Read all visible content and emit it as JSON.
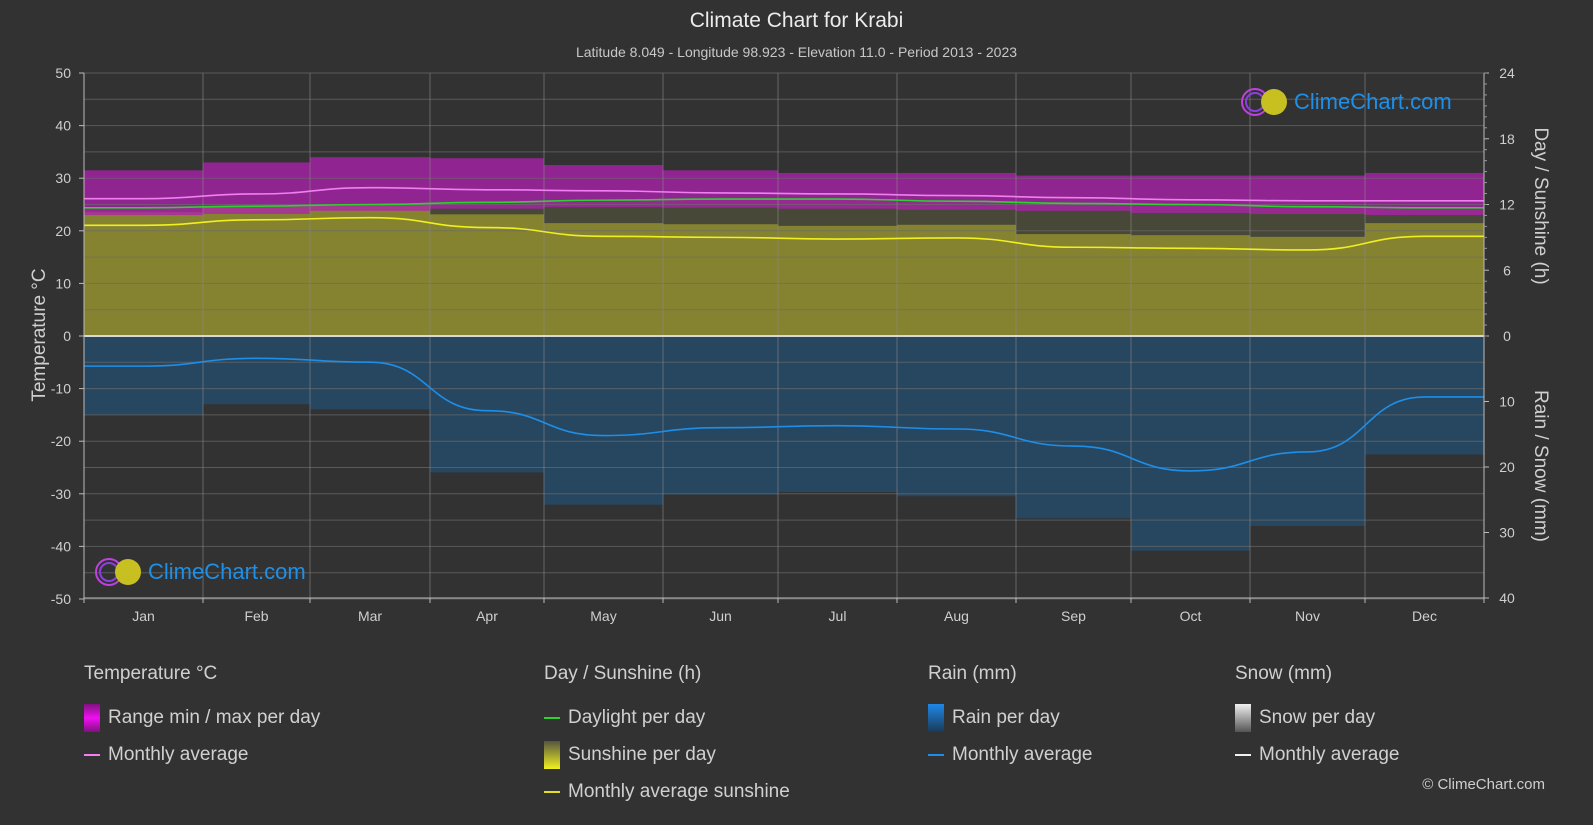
{
  "header": {
    "title": "Climate Chart for Krabi",
    "subtitle": "Latitude 8.049 - Longitude 98.923 - Elevation 11.0 - Period 2013 - 2023"
  },
  "logo": {
    "text": "ClimeChart.com"
  },
  "copyright": "© ClimeChart.com",
  "colors": {
    "background": "#323232",
    "temp_range": "#b020b0",
    "temp_avg": "#f080f0",
    "daylight": "#30d030",
    "sunshine_fill": "#8c8a30",
    "sunshine_avg": "#f0f020",
    "rain_fill": "#1f5a88",
    "rain_avg": "#1e8ee8",
    "grid": "#6a6a6a",
    "logo_text": "#1e90e8"
  },
  "legend": {
    "temperature": {
      "title": "Temperature °C",
      "items": [
        "Range min / max per day",
        "Monthly average"
      ]
    },
    "sunshine": {
      "title": "Day / Sunshine (h)",
      "items": [
        "Daylight per day",
        "Sunshine per day",
        "Monthly average sunshine"
      ]
    },
    "rain": {
      "title": "Rain (mm)",
      "items": [
        "Rain per day",
        "Monthly average"
      ]
    },
    "snow": {
      "title": "Snow (mm)",
      "items": [
        "Snow per day",
        "Monthly average"
      ]
    }
  },
  "chart_data": {
    "type": "line",
    "title": "Climate Chart for Krabi",
    "categories": [
      "Jan",
      "Feb",
      "Mar",
      "Apr",
      "May",
      "Jun",
      "Jul",
      "Aug",
      "Sep",
      "Oct",
      "Nov",
      "Dec"
    ],
    "left_axis": {
      "label": "Temperature °C",
      "range": [
        -50,
        50
      ],
      "ticks": [
        50,
        40,
        30,
        20,
        10,
        0,
        -10,
        -20,
        -30,
        -40,
        -50
      ]
    },
    "right_axis_top": {
      "label": "Day / Sunshine (h)",
      "range": [
        0,
        24
      ],
      "ticks": [
        24,
        18,
        12,
        6,
        0
      ]
    },
    "right_axis_bottom": {
      "label": "Rain / Snow (mm)",
      "range": [
        0,
        40
      ],
      "ticks": [
        10,
        20,
        30,
        40
      ]
    },
    "grid": true,
    "series": [
      {
        "name": "Temperature monthly average",
        "unit": "°C",
        "values": [
          26.1,
          27.0,
          28.2,
          27.8,
          27.6,
          27.2,
          27.0,
          26.7,
          26.3,
          25.9,
          25.7,
          25.7
        ]
      },
      {
        "name": "Temperature range min",
        "unit": "°C",
        "values": [
          23.0,
          23.2,
          23.8,
          24.2,
          24.5,
          24.4,
          24.2,
          24.0,
          23.8,
          23.4,
          23.2,
          23.0
        ]
      },
      {
        "name": "Temperature range max",
        "unit": "°C",
        "values": [
          31.5,
          33.0,
          34.0,
          33.8,
          32.5,
          31.5,
          31.0,
          31.0,
          30.5,
          30.5,
          30.5,
          31.0
        ]
      },
      {
        "name": "Daylight per day",
        "unit": "h",
        "values": [
          11.7,
          11.85,
          12.0,
          12.2,
          12.4,
          12.5,
          12.5,
          12.3,
          12.1,
          12.0,
          11.8,
          11.7
        ]
      },
      {
        "name": "Monthly average sunshine",
        "unit": "h",
        "values": [
          10.1,
          10.6,
          10.8,
          9.9,
          9.1,
          9.0,
          8.85,
          8.95,
          8.1,
          8.0,
          7.85,
          9.1
        ]
      },
      {
        "name": "Rain monthly average",
        "unit": "mm",
        "values": [
          4.6,
          3.4,
          4.0,
          11.4,
          15.2,
          14.0,
          13.7,
          14.2,
          16.8,
          20.6,
          17.7,
          9.3
        ]
      },
      {
        "name": "Snow monthly average",
        "unit": "mm",
        "values": [
          0,
          0,
          0,
          0,
          0,
          0,
          0,
          0,
          0,
          0,
          0,
          0
        ]
      }
    ]
  }
}
